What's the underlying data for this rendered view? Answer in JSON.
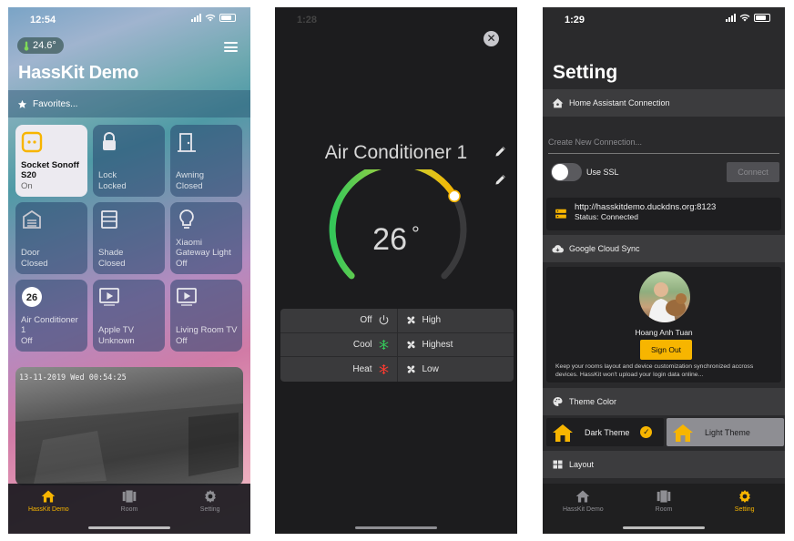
{
  "screen1": {
    "time": "12:54",
    "temperature": "24.6°",
    "app_title": "HassKit Demo",
    "favorites_label": "Favorites...",
    "tiles": [
      {
        "name": "Socket Sonoff S20",
        "state": "On",
        "icon": "socket-icon",
        "active": true
      },
      {
        "name": "Lock",
        "state": "Locked",
        "icon": "lock-icon",
        "active": false
      },
      {
        "name": "Awning",
        "state": "Closed",
        "icon": "door-icon",
        "active": false
      },
      {
        "name": "Door",
        "state": "Closed",
        "icon": "garage-icon",
        "active": false
      },
      {
        "name": "Shade",
        "state": "Closed",
        "icon": "shade-icon",
        "active": false
      },
      {
        "name": "Xiaomi Gateway Light",
        "state": "Off",
        "icon": "bulb-icon",
        "active": false
      },
      {
        "name": "Air Conditioner 1",
        "state": "Off",
        "icon": "thermostat-icon",
        "badge": "26",
        "active": false
      },
      {
        "name": "Apple TV",
        "state": "Unknown",
        "icon": "tv-icon",
        "active": false
      },
      {
        "name": "Living Room TV",
        "state": "Off",
        "icon": "tv-icon",
        "active": false
      }
    ],
    "camera_timestamp": "13-11-2019 Wed 00:54:25",
    "tabs": [
      {
        "label": "HassKit Demo",
        "icon": "home-icon",
        "active": true
      },
      {
        "label": "Room",
        "icon": "room-icon",
        "active": false
      },
      {
        "label": "Setting",
        "icon": "gear-icon",
        "active": false
      }
    ]
  },
  "screen2": {
    "time": "1:28",
    "title": "Air Conditioner 1",
    "temperature_value": "26",
    "temperature_unit": "°",
    "gauge_fraction": 0.72,
    "modes": [
      {
        "label": "Off",
        "icon": "power-icon",
        "color": "#d8d8d8"
      },
      {
        "label": "Cool",
        "icon": "snowflake-icon",
        "color": "#34c759"
      },
      {
        "label": "Heat",
        "icon": "heat-icon",
        "color": "#ff3b30"
      }
    ],
    "fan_speeds": [
      {
        "label": "High",
        "icon": "fan-icon"
      },
      {
        "label": "Highest",
        "icon": "fan-icon"
      },
      {
        "label": "Low",
        "icon": "fan-icon"
      }
    ]
  },
  "screen3": {
    "time": "1:29",
    "title": "Setting",
    "ha_section": "Home Assistant Connection",
    "new_connection_placeholder": "Create New Connection...",
    "ssl_label": "Use SSL",
    "connect_label": "Connect",
    "server_url": "http://hasskitdemo.duckdns.org:8123",
    "server_status": "Status: Connected",
    "cloud_section": "Google Cloud Sync",
    "user_name": "Hoang Anh Tuan",
    "signout_label": "Sign Out",
    "sync_description": "Keep your rooms layout and device customization synchronized accross devices. HassKit won't upload your login data online...",
    "theme_section": "Theme Color",
    "dark_theme": "Dark Theme",
    "light_theme": "Light Theme",
    "layout_section": "Layout",
    "tabs": [
      {
        "label": "HassKit Demo",
        "icon": "home-icon",
        "active": false
      },
      {
        "label": "Room",
        "icon": "room-icon",
        "active": false
      },
      {
        "label": "Setting",
        "icon": "gear-icon",
        "active": true
      }
    ]
  },
  "colors": {
    "accent": "#f7b500",
    "gauge_start": "#34c759",
    "gauge_end": "#f7b500"
  }
}
